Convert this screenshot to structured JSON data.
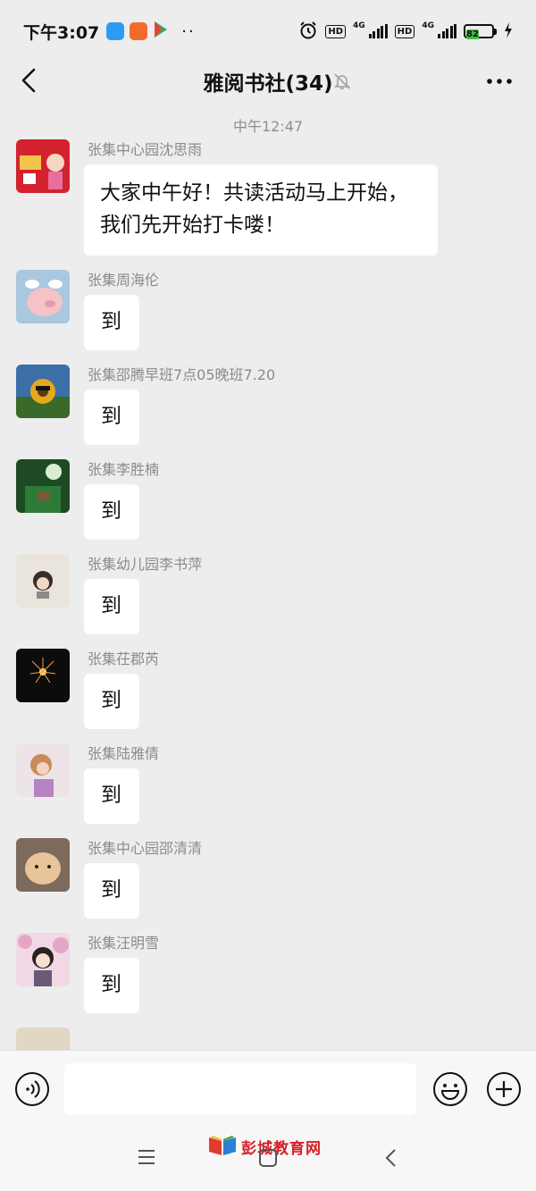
{
  "status_bar": {
    "time": "下午3:07",
    "more": "··",
    "net1": "4G",
    "net2": "4G",
    "hd1": "HD",
    "hd2": "HD",
    "battery": "82"
  },
  "header": {
    "title": "雅阅书社(34)"
  },
  "chat": {
    "timestamp": "中午12:47",
    "messages": [
      {
        "sender": "张集中心园沈思雨",
        "text": "大家中午好！共读活动马上开始，我们先开始打卡喽！"
      },
      {
        "sender": "张集周海伦",
        "text": "到"
      },
      {
        "sender": "张集邵腾早班7点05晚班7.20",
        "text": "到"
      },
      {
        "sender": "张集李胜楠",
        "text": "到"
      },
      {
        "sender": "张集幼儿园李书萍",
        "text": "到"
      },
      {
        "sender": "张集茌郡芮",
        "text": "到"
      },
      {
        "sender": "张集陆雅倩",
        "text": "到"
      },
      {
        "sender": "张集中心园邵清清",
        "text": "到"
      },
      {
        "sender": "张集汪明雪",
        "text": "到"
      }
    ]
  },
  "input": {
    "value": ""
  },
  "watermark": {
    "text": "彭城教育网"
  },
  "colors": {
    "background": "#ededed",
    "bubble": "#ffffff",
    "sender_name": "#8b8b8b",
    "watermark": "#d41f26",
    "battery": "#3fbf3f"
  }
}
